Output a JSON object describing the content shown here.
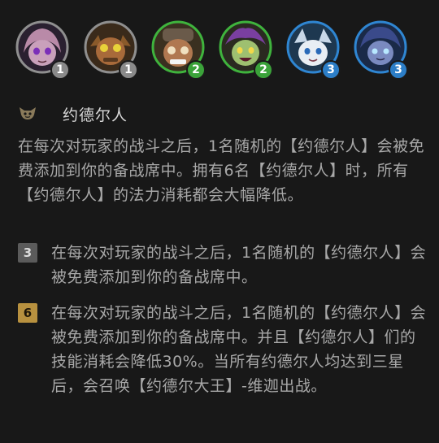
{
  "champions": [
    {
      "cost": "1",
      "badge_color": "#8a8a8a",
      "ring": "#8f8f8f"
    },
    {
      "cost": "1",
      "badge_color": "#8a8a8a",
      "ring": "#8f8f8f"
    },
    {
      "cost": "2",
      "badge_color": "#3ba33a",
      "ring": "#3fb33d"
    },
    {
      "cost": "2",
      "badge_color": "#3ba33a",
      "ring": "#3fb33d"
    },
    {
      "cost": "3",
      "badge_color": "#2c7ec7",
      "ring": "#2f86d2"
    },
    {
      "cost": "3",
      "badge_color": "#2c7ec7",
      "ring": "#2f86d2"
    }
  ],
  "trait": {
    "icon": "yordle-trait-icon",
    "name": "约德尔人",
    "description": "在每次对玩家的战斗之后，1名随机的【约德尔人】会被免费添加到你的备战席中。拥有6名【约德尔人】时，所有【约德尔人】的法力消耗都会大幅降低。"
  },
  "tiers": [
    {
      "count": "3",
      "badge_color": "#5b5b5b",
      "text_color": "#dcdcdc",
      "text": "在每次对玩家的战斗之后，1名随机的【约德尔人】会被免费添加到你的备战席中。"
    },
    {
      "count": "6",
      "badge_color": "#b8913f",
      "text_color": "#1e1608",
      "text": "在每次对玩家的战斗之后，1名随机的【约德尔人】会被免费添加到你的备战席中。并且【约德尔人】们的技能消耗会降低30%。当所有约德尔人均达到三星后，会召唤【约德尔大王】-维迦出战。"
    }
  ]
}
